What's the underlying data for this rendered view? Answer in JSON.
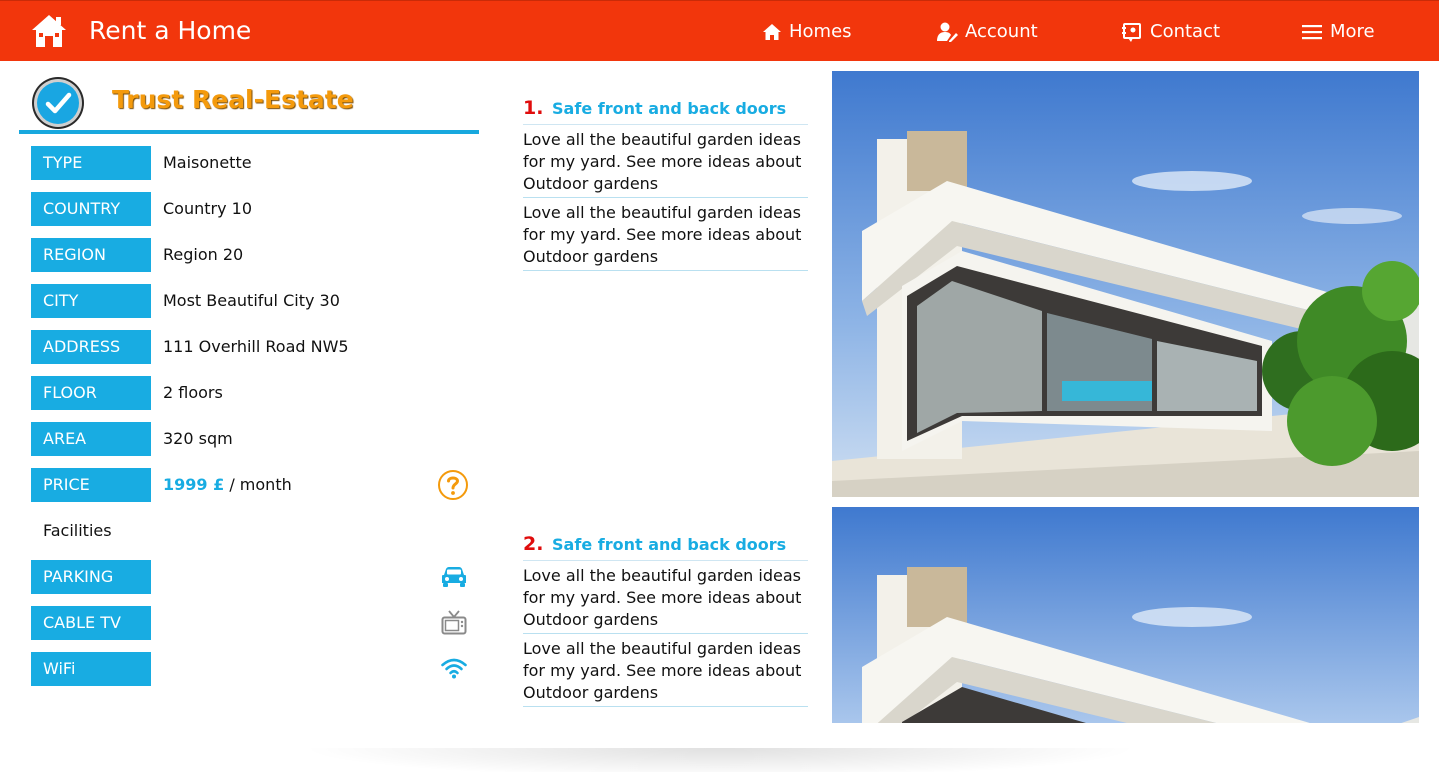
{
  "header": {
    "title": "Rent a Home",
    "nav": [
      {
        "label": "Homes",
        "icon": "home-icon"
      },
      {
        "label": "Account",
        "icon": "user-edit-icon"
      },
      {
        "label": "Contact",
        "icon": "contact-book-icon"
      },
      {
        "label": "More",
        "icon": "menu-icon"
      }
    ],
    "color": "#f2360c"
  },
  "agency": {
    "name": "Trust Real-Estate",
    "badge_icon": "check-circle-icon"
  },
  "details": [
    {
      "label": "TYPE",
      "value": "Maisonette"
    },
    {
      "label": "COUNTRY",
      "value": "Country 10"
    },
    {
      "label": "REGION",
      "value": "Region 20"
    },
    {
      "label": "CITY",
      "value": "Most Beautiful City 30"
    },
    {
      "label": "ADDRESS",
      "value": "111 Overhill Road NW5"
    },
    {
      "label": "FLOOR",
      "value": "2 floors"
    },
    {
      "label": "AREA",
      "value": "320 sqm"
    }
  ],
  "price": {
    "label": "PRICE",
    "amount": "1999 £",
    "period": "/ month",
    "help_icon": "question-circle-icon"
  },
  "facilities": {
    "heading": "Facilities",
    "items": [
      {
        "label": "PARKING",
        "icon": "car-icon"
      },
      {
        "label": "CABLE TV",
        "icon": "tv-icon"
      },
      {
        "label": "WiFi",
        "icon": "wifi-icon"
      }
    ]
  },
  "features": [
    {
      "number": "1.",
      "title": "Safe front and back doors",
      "descriptions": [
        "Love all the beautiful garden ideas for my yard. See more ideas about Outdoor gardens",
        "Love all the beautiful garden ideas for my yard. See more ideas about Outdoor gardens"
      ]
    },
    {
      "number": "2.",
      "title": "Safe front and back doors",
      "descriptions": [
        "Love all the beautiful garden ideas for my yard. See more ideas about Outdoor gardens",
        "Love all the beautiful garden ideas for my yard. See more ideas about Outdoor gardens"
      ]
    }
  ],
  "colors": {
    "accent": "#18ace2",
    "brand": "#f2360c",
    "agency": "#f49a0c",
    "feature_number": "#e00c0c"
  }
}
